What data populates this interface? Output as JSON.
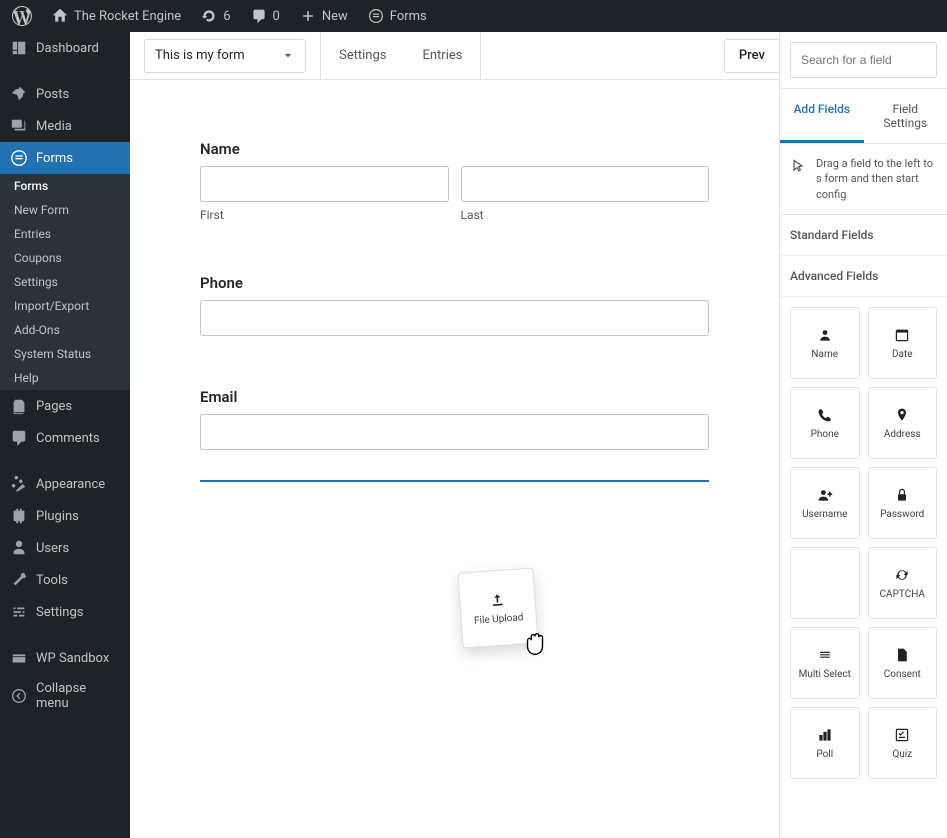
{
  "toolbar": {
    "site_name": "The Rocket Engine",
    "updates_count": "6",
    "comments_count": "0",
    "new_label": "New",
    "forms_label": "Forms"
  },
  "sidebar": {
    "dashboard": "Dashboard",
    "posts": "Posts",
    "media": "Media",
    "forms": "Forms",
    "pages": "Pages",
    "comments": "Comments",
    "appearance": "Appearance",
    "plugins": "Plugins",
    "users": "Users",
    "tools": "Tools",
    "settings": "Settings",
    "sandbox": "WP Sandbox",
    "collapse": "Collapse menu",
    "sub": {
      "forms": "Forms",
      "new_form": "New Form",
      "entries": "Entries",
      "coupons": "Coupons",
      "settings": "Settings",
      "import_export": "Import/Export",
      "addons": "Add-Ons",
      "system_status": "System Status",
      "help": "Help"
    }
  },
  "editor": {
    "form_name": "This is my form",
    "tab_settings": "Settings",
    "tab_entries": "Entries",
    "preview": "Prev"
  },
  "form": {
    "name_label": "Name",
    "first_label": "First",
    "last_label": "Last",
    "phone_label": "Phone",
    "email_label": "Email"
  },
  "dragging": {
    "label": "File Upload"
  },
  "right": {
    "search_placeholder": "Search for a field",
    "tab_add": "Add Fields",
    "tab_settings": "Field Settings",
    "help_text": "Drag a field to the left to s form and then start config",
    "standard_title": "Standard Fields",
    "advanced_title": "Advanced Fields",
    "fields": {
      "name": "Name",
      "date": "Date",
      "phone": "Phone",
      "address": "Address",
      "username": "Username",
      "password": "Password",
      "captcha": "CAPTCHA",
      "multiselect": "Multi Select",
      "consent": "Consent",
      "poll": "Poll",
      "quiz": "Quiz"
    }
  }
}
